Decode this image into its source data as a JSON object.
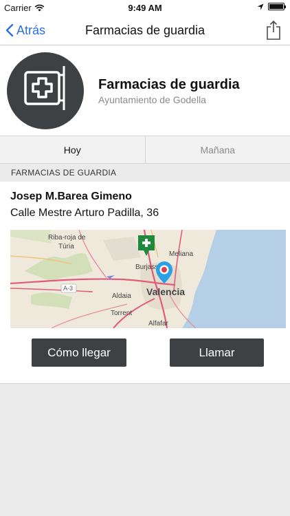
{
  "status_bar": {
    "carrier": "Carrier",
    "time": "9:49 AM"
  },
  "nav": {
    "back_label": "Atrás",
    "title": "Farmacias de guardia"
  },
  "header": {
    "title": "Farmacias de guardia",
    "subtitle": "Ayuntamiento de Godella"
  },
  "tabs": [
    {
      "label": "Hoy",
      "active": true
    },
    {
      "label": "Mañana",
      "active": false
    }
  ],
  "section": {
    "title": "FARMACIAS DE GUARDIA"
  },
  "pharmacy": {
    "name": "Josep M.Barea Gimeno",
    "address": "Calle Mestre Arturo Padilla, 36",
    "map_labels": {
      "riba_roja_1": "Riba-roja de",
      "riba_roja_2": "Túria",
      "burjassot": "Burjassot",
      "meliana": "Meliana",
      "a3": "A-3",
      "aldaia": "Aldaia",
      "valencia": "Valencia",
      "torrent": "Torrent",
      "alfafar": "Alfafar"
    }
  },
  "actions": {
    "directions_label": "Cómo llegar",
    "call_label": "Llamar"
  },
  "colors": {
    "accent": "#2a6fd8",
    "dark_button": "#3d4143",
    "pharmacy_pin": "#1e8a3c",
    "location_pin": "#2aa0e6"
  }
}
